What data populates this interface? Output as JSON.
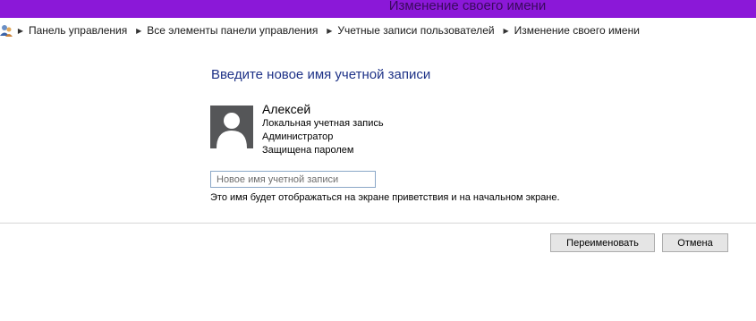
{
  "window": {
    "title": "Изменение своего имени"
  },
  "breadcrumb": {
    "icon": "users-icon",
    "items": [
      "Панель управления",
      "Все элементы панели управления",
      "Учетные записи пользователей",
      "Изменение своего имени"
    ]
  },
  "main": {
    "heading": "Введите новое имя учетной записи",
    "user": {
      "name": "Алексей",
      "account_type": "Локальная учетная запись",
      "role": "Администратор",
      "password_status": "Защищена паролем",
      "avatar_icon": "user-avatar-icon"
    },
    "new_name_input": {
      "value": "",
      "placeholder": "Новое имя учетной записи"
    },
    "hint": "Это имя будет отображаться на экране приветствия и на начальном экране."
  },
  "buttons": {
    "rename_label": "Переименовать",
    "cancel_label": "Отмена"
  },
  "colors": {
    "titlebar": "#8b18d8",
    "heading": "#1e3287",
    "avatar_bg": "#555658"
  }
}
